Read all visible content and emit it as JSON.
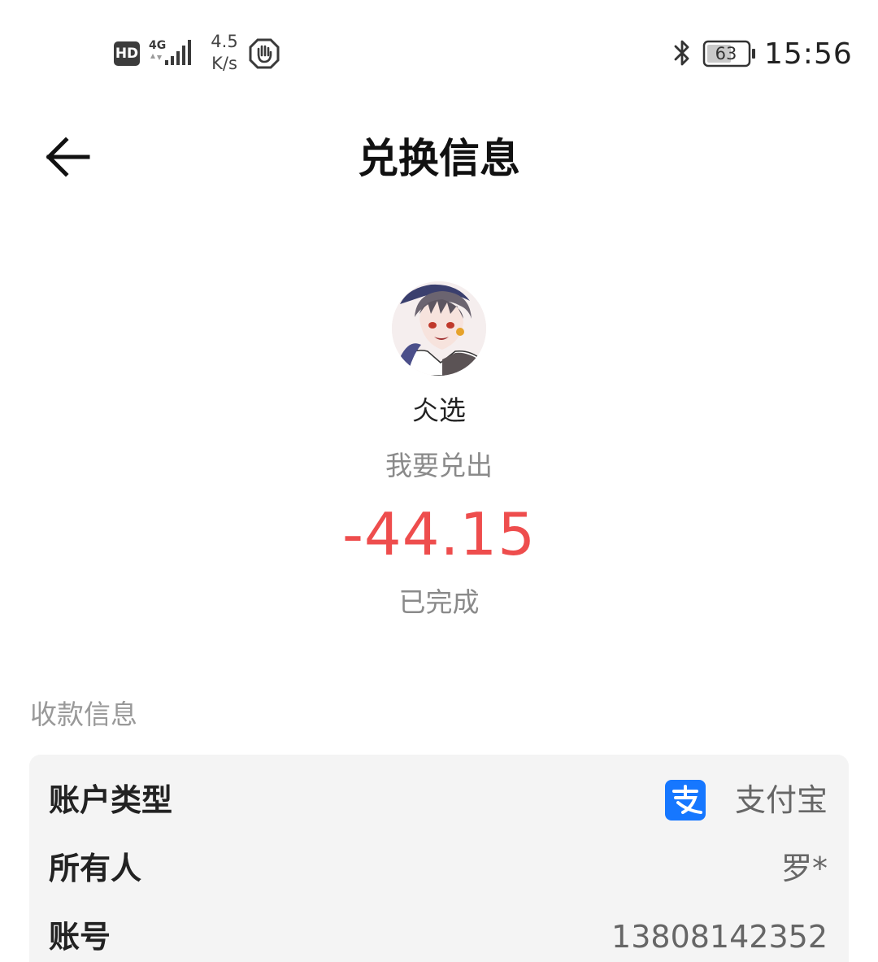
{
  "status_bar": {
    "hd": "HD",
    "network": "4G",
    "speed_value": "4.5",
    "speed_unit": "K/s",
    "battery": "63",
    "time": "15:56"
  },
  "header": {
    "title": "兑换信息",
    "back_icon": "arrow-left-icon"
  },
  "profile": {
    "name": "仌选",
    "action": "我要兑出",
    "amount": "-44.15",
    "status": "已完成"
  },
  "colors": {
    "amount": "#ee4d4d",
    "alipay": "#1677ff",
    "card_bg": "#f4f4f4"
  },
  "payee": {
    "section_title": "收款信息",
    "rows": [
      {
        "label": "账户类型",
        "value": "支付宝",
        "icon": "alipay-icon"
      },
      {
        "label": "所有人",
        "value": "罗*"
      },
      {
        "label": "账号",
        "value": "13808142352"
      }
    ]
  }
}
